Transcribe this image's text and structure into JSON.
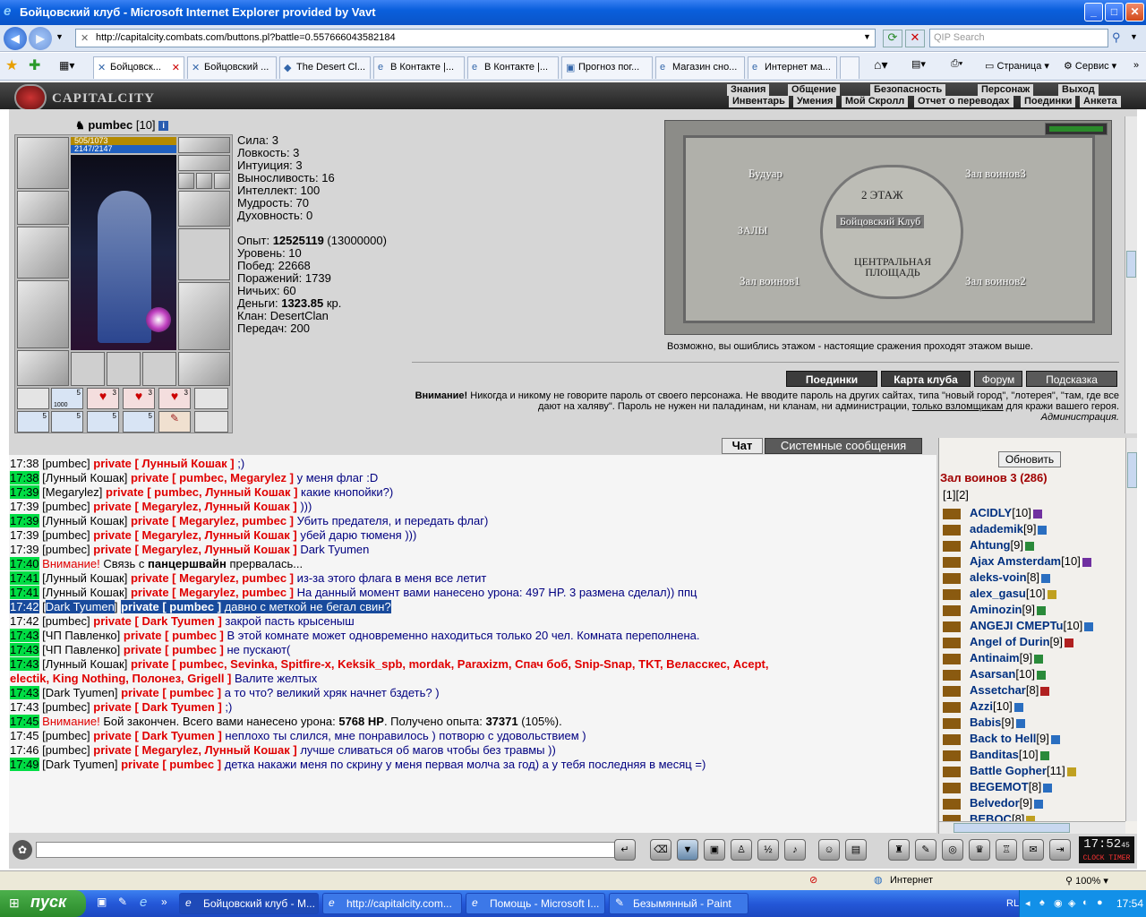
{
  "window": {
    "title": "Бойцовский клуб - Microsoft Internet Explorer provided by Vavt"
  },
  "address": {
    "url": "http://capitalcity.combats.com/buttons.pl?battle=0.557666043582184",
    "search_placeholder": "QIP Search"
  },
  "tabs": [
    "Бойцовск...",
    "Бойцовский ...",
    "The Desert Cl...",
    "В Контакте |...",
    "В Контакте |...",
    "Прогноз пог...",
    "Магазин сно...",
    "Интернет ма..."
  ],
  "toolbar": {
    "page": "Страница",
    "service": "Сервис"
  },
  "header": {
    "logo": "CAPITALCITY",
    "top_links": [
      "Знания",
      "Общение",
      "Безопасность",
      "Персонаж",
      "Выход"
    ],
    "sub_links": [
      "Инвентарь",
      "Умения",
      "Мой Скролл",
      "Отчет о переводах",
      "Поединки",
      "Анкета"
    ]
  },
  "character": {
    "name": "pumbec",
    "level": "[10]",
    "hp": "505/1073",
    "mana": "2147/2147",
    "stats": [
      "Сила: 3",
      "Ловкость: 3",
      "Интуиция: 3",
      "Выносливость: 16",
      "Интеллект: 100",
      "Мудрость: 70",
      "Духовность: 0"
    ],
    "exp_label": "Опыт: ",
    "exp_value": "12525119",
    "exp_next": " (13000000)",
    "info": [
      "Уровень: 10",
      "Побед: 22668",
      "Поражений: 1739",
      "Ничьих: 60"
    ],
    "money_label": "Деньги: ",
    "money_value": "1323.85",
    "money_unit": " кр.",
    "clan": "Клан: DesertClan",
    "transfers": "Передач: 200",
    "belt_counts": [
      "5",
      "5",
      "3",
      "3",
      "3",
      "5",
      "5",
      "5",
      "5"
    ],
    "belt_sub": "1000"
  },
  "map": {
    "rooms": [
      "Будуар",
      "Зал воинов3",
      "2 ЭТАЖ",
      "Бойцовский Клуб",
      "ЗАЛЫ",
      "ЦЕНТРАЛЬНАЯ ПЛОЩАДЬ",
      "Зал воинов1",
      "Зал воинов2"
    ],
    "note": "Возможно, вы ошиблись этажом - настоящие сражения проходят этажом выше."
  },
  "menu_buttons": [
    "Поединки",
    "Карта клуба",
    "Форум",
    "Подсказка"
  ],
  "warning": {
    "bold": "Внимание!",
    "text": " Никогда и никому не говорите пароль от своего персонажа. Не вводите пароль на других сайтах, типа \"новый город\", \"лотерея\", \"там, где все дают на халяву\". Пароль не нужен ни паладинам, ни кланам, ни администрации, ",
    "link": "только взломщикам",
    "text2": " для кражи вашего героя.",
    "sign": "Администрация."
  },
  "chat_tabs": [
    "Чат",
    "Системные сообщения"
  ],
  "chat": [
    {
      "t": "17:38",
      "g": false,
      "u": "pumbec",
      "p": "private [ Лунный Кошак ]",
      "m": " ;)"
    },
    {
      "t": "17:38",
      "g": true,
      "u": "Лунный Кошак",
      "p": "private [ pumbec, Megarylez ]",
      "m": " у меня флаг :D"
    },
    {
      "t": "17:39",
      "g": true,
      "u": "Megarylez",
      "p": "private [ pumbec, Лунный Кошак ]",
      "m": " какие кнопойки?)"
    },
    {
      "t": "17:39",
      "g": false,
      "u": "pumbec",
      "p": "private [ Megarylez, Лунный Кошак ]",
      "m": " )))"
    },
    {
      "t": "17:39",
      "g": true,
      "u": "Лунный Кошак",
      "p": "private [ Megarylez, pumbec ]",
      "m": " Убить предателя, и передать флаг)"
    },
    {
      "t": "17:39",
      "g": false,
      "u": "pumbec",
      "p": "private [ Megarylez, Лунный Кошак ]",
      "m": " убей дарю тюменя )))"
    },
    {
      "t": "17:39",
      "g": false,
      "u": "pumbec",
      "p": "private [ Megarylez, Лунный Кошак ]",
      "m": " Dark Tyumen"
    },
    {
      "t": "17:40",
      "g": true,
      "sys": "Внимание!",
      "m": " Связь с ",
      "b": "панцершвайн",
      "m2": " прервалась..."
    },
    {
      "t": "17:41",
      "g": true,
      "u": "Лунный Кошак",
      "p": "private [ Megarylez, pumbec ]",
      "m": "            из-за этого флага в меня все летит"
    },
    {
      "t": "17:41",
      "g": true,
      "u": "Лунный Кошак",
      "p": "private [ Megarylez, pumbec ]",
      "m": " На данный момент вами нанесено урона: 497 HP. 3 размена сделал)) ппц"
    },
    {
      "t": "17:42",
      "g": false,
      "sel": true,
      "u": "Dark Tyumen",
      "p": "private [ pumbec ]",
      "m": " давно с меткой не бегал свин?"
    },
    {
      "t": "17:42",
      "g": false,
      "u": "pumbec",
      "p": "private [ Dark Tyumen ]",
      "m": " закрой пасть крысеныш"
    },
    {
      "t": "17:43",
      "g": true,
      "u": "ЧП Павленко",
      "p": "private [ pumbec ]",
      "m": " В этой комнате может одновременно находиться только 20 чел. Комната переполнена."
    },
    {
      "t": "17:43",
      "g": true,
      "u": "ЧП Павленко",
      "p": "private [ pumbec ]",
      "m": " не пускают("
    },
    {
      "t": "17:43",
      "g": true,
      "u": "Лунный Кошак",
      "p": "private [ pumbec, Sevinka, Spitfire-x, Keksik_spb, mordak, Paraxizm, Спач боб, Snip-Snap, TKT, Веласскес, Acept,",
      "m": ""
    },
    {
      "cont": true,
      "p": "electik, King Nothing, Полонез, Grigell ]",
      "m": " Валите желтых"
    },
    {
      "t": "17:43",
      "g": true,
      "u": "Dark Tyumen",
      "p": "private [ pumbec ]",
      "m": " а то что? великий хряк начнет бздеть? )"
    },
    {
      "t": "17:43",
      "g": false,
      "u": "pumbec",
      "p": "private [ Dark Tyumen ]",
      "m": " ;)"
    },
    {
      "t": "17:45",
      "g": true,
      "sys": "Внимание!",
      "m": " Бой закончен. Всего вами нанесено урона: ",
      "b": "5768 HP",
      "m2": ". Получено опыта: ",
      "b2": "37371",
      "m3": " (105%)."
    },
    {
      "t": "17:45",
      "g": false,
      "u": "pumbec",
      "p": "private [ Dark Tyumen ]",
      "m": " неплохо ты слился, мне понравилось ) потворю с удовольствием )"
    },
    {
      "t": "17:46",
      "g": false,
      "u": "pumbec",
      "p": "private [ Megarylez, Лунный Кошак ]",
      "m": " лучше сливаться об магов чтобы без травмы ))"
    },
    {
      "t": "17:49",
      "g": true,
      "u": "Dark Tyumen",
      "p": "private [ pumbec ]",
      "m": " детка накажи меня по скрину у меня первая молча за год) а у тебя последняя в месяц =)"
    }
  ],
  "right": {
    "refresh": "Обновить",
    "room": "Зал воинов 3 (286)",
    "pages": "[1][2]",
    "players": [
      {
        "n": "ACIDLY",
        "l": "[10]",
        "c": "ip"
      },
      {
        "n": "adademik",
        "l": "[9]",
        "c": ""
      },
      {
        "n": "Ahtung",
        "l": "[9]",
        "c": "ig"
      },
      {
        "n": "Ajax Amsterdam",
        "l": "[10]",
        "c": "ip"
      },
      {
        "n": "aleks-voin",
        "l": "[8]",
        "c": ""
      },
      {
        "n": "alex_gasu",
        "l": "[10]",
        "c": "iy"
      },
      {
        "n": "Aminozin",
        "l": "[9]",
        "c": "ig"
      },
      {
        "n": "ANGEJI CMEPTu",
        "l": "[10]",
        "c": ""
      },
      {
        "n": "Angel of Durin",
        "l": "[9]",
        "c": "ir"
      },
      {
        "n": "Antinaim",
        "l": "[9]",
        "c": "ig"
      },
      {
        "n": "Asarsan",
        "l": "[10]",
        "c": "ig"
      },
      {
        "n": "Assetchar",
        "l": "[8]",
        "c": "ir"
      },
      {
        "n": "Azzi",
        "l": "[10]",
        "c": ""
      },
      {
        "n": "Babis",
        "l": "[9]",
        "c": ""
      },
      {
        "n": "Back to Hell",
        "l": "[9]",
        "c": ""
      },
      {
        "n": "Banditas",
        "l": "[10]",
        "c": "ig"
      },
      {
        "n": "Battle Gopher",
        "l": "[11]",
        "c": "iy"
      },
      {
        "n": "BEGEMOT",
        "l": "[8]",
        "c": ""
      },
      {
        "n": "Belvedor",
        "l": "[9]",
        "c": ""
      },
      {
        "n": "BEBOC",
        "l": "[8]",
        "c": "iy"
      }
    ]
  },
  "clock": {
    "time": "17:52",
    "sec": "45",
    "label": "CLOCK TIMER"
  },
  "status": {
    "zone": "Интернет",
    "zoom": "100%"
  },
  "taskbar": {
    "start": "пуск",
    "items": [
      "Бойцовский клуб - М...",
      "http://capitalcity.com...",
      "Помощь - Microsoft I...",
      "Безымянный - Paint"
    ],
    "lang": "RL",
    "time": "17:54"
  }
}
